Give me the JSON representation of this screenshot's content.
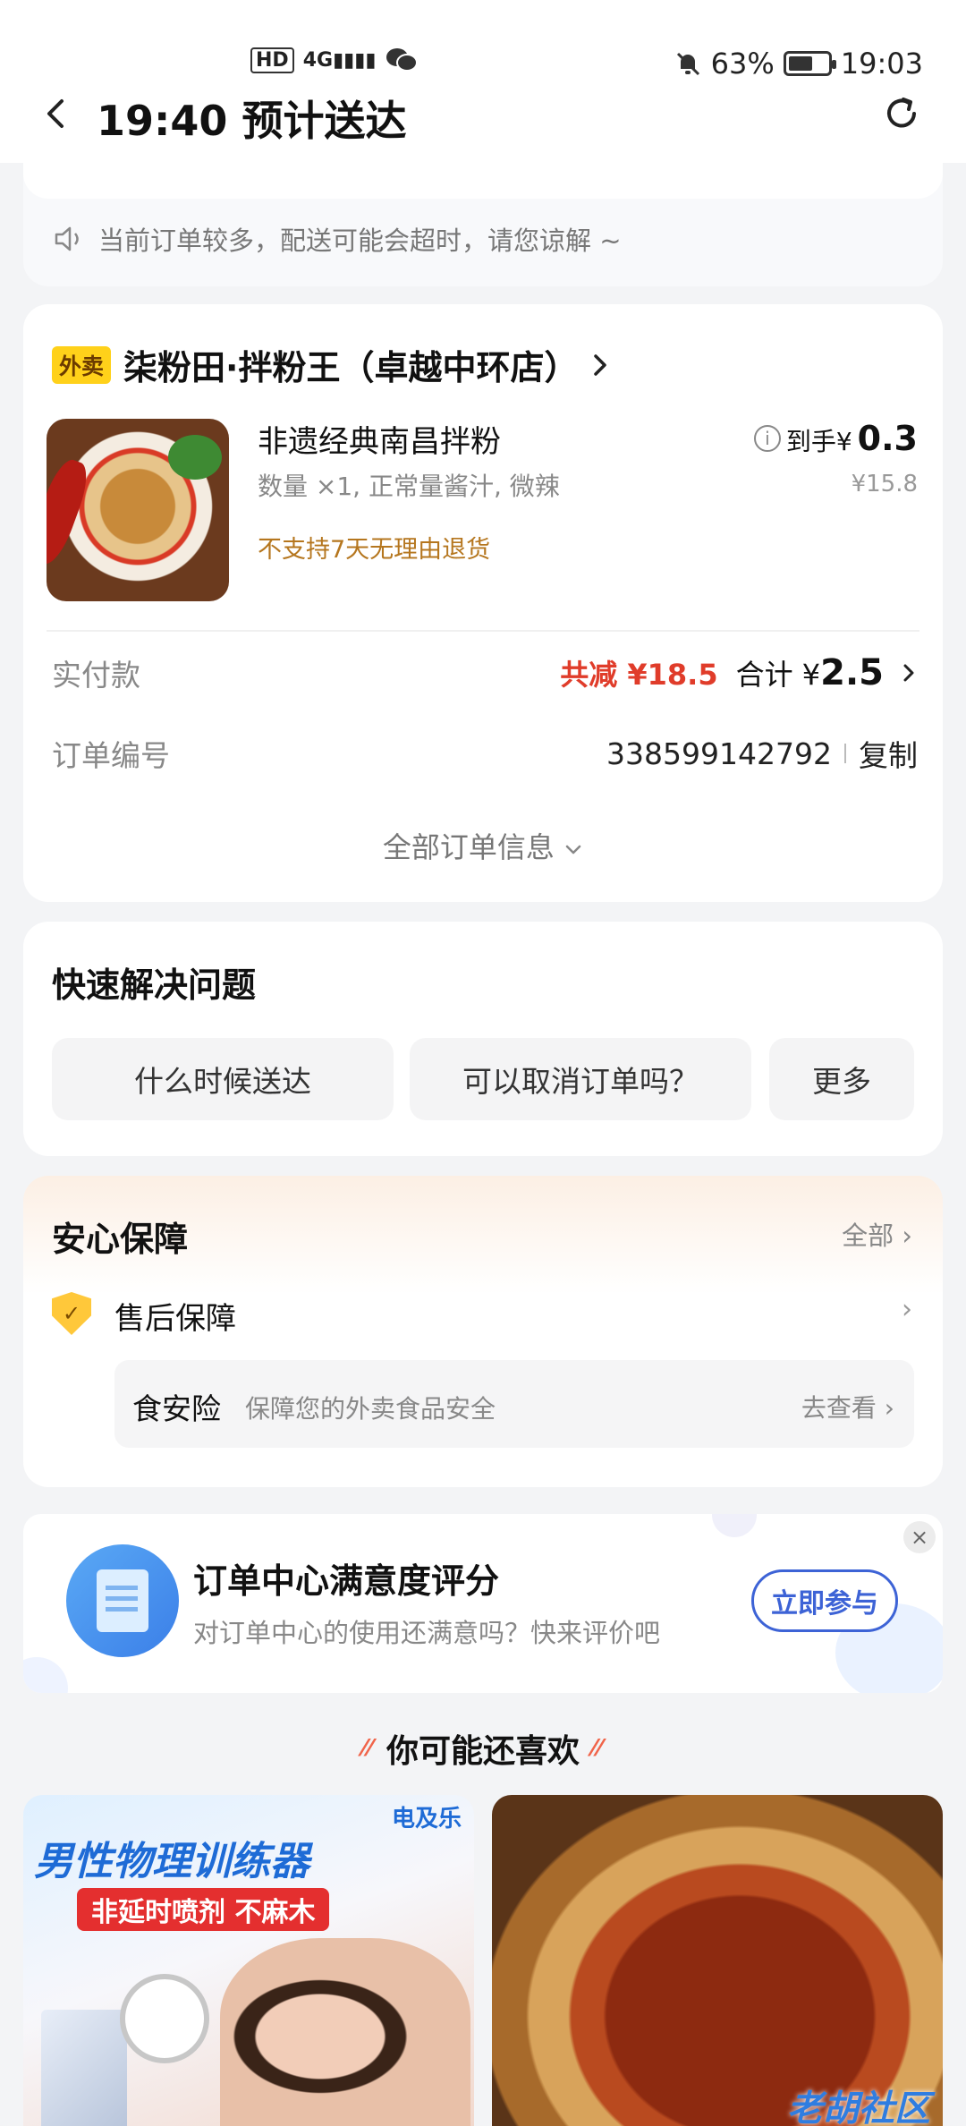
{
  "status_bar": {
    "left_icons": [
      "hd-icon",
      "signal-4g-icon",
      "wechat-icon"
    ],
    "hd": "HD",
    "net": "4G",
    "battery_percent": "63%",
    "battery_level": 0.63,
    "time": "19:03"
  },
  "header": {
    "title": "19:40 预计送达"
  },
  "notice": {
    "text": "当前订单较多，配送可能会超时，请您谅解 ~"
  },
  "order": {
    "tag": "外卖",
    "shop_name": "柒粉田·拌粉王（卓越中环店）",
    "item": {
      "name": "非遗经典南昌拌粉",
      "spec": "数量 ×1, 正常量酱汁, 微辣",
      "warning": "不支持7天无理由退货",
      "final_label": "到手¥",
      "final_price": "0.3",
      "original_price": "¥15.8"
    },
    "payment": {
      "label": "实付款",
      "discount": "共减 ¥18.5",
      "total_label": "合计 ¥",
      "total_value": "2.5"
    },
    "order_no": {
      "label": "订单编号",
      "value": "338599142792",
      "copy_label": "复制"
    },
    "all_info_label": "全部订单信息"
  },
  "quick_solve": {
    "title": "快速解决问题",
    "buttons": [
      "什么时候送达",
      "可以取消订单吗？",
      "更多"
    ]
  },
  "guarantee": {
    "title": "安心保障",
    "all_label": "全部",
    "after_sale_label": "售后保障",
    "insurance": {
      "name": "食安险",
      "desc": "保障您的外卖食品安全",
      "action": "去查看"
    }
  },
  "survey": {
    "title": "订单中心满意度评分",
    "subtitle": "对订单中心的使用还满意吗？快来评价吧",
    "button": "立即参与",
    "close": "×"
  },
  "recommend": {
    "title": "你可能还喜欢",
    "ad": {
      "line1": "男性物理训练器",
      "line2": "非延时喷剂 不麻木",
      "brand": "电及乐"
    },
    "watermark": "老胡社区"
  },
  "colors": {
    "accent_red": "#e03c2a",
    "accent_blue": "#3d63d6",
    "warn_orange": "#b5761e",
    "tag_yellow": "#ffd11a"
  }
}
